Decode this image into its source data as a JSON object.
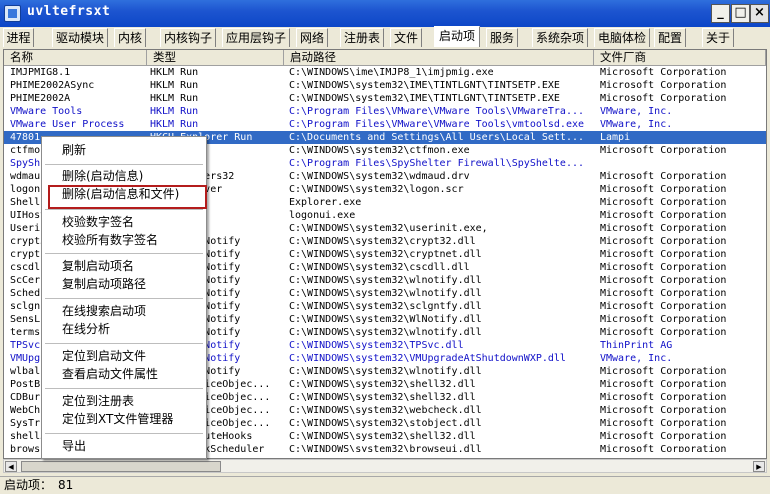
{
  "window": {
    "title": "uvltefrsxt",
    "controls": [
      "_",
      "□",
      "×"
    ]
  },
  "tabs": [
    "进程",
    "驱动模块",
    "内核",
    "内核钩子",
    "应用层钩子",
    "网络",
    "注册表",
    "文件",
    "启动项",
    "服务",
    "系统杂项",
    "电脑体检",
    "配置",
    "关于"
  ],
  "active_tab": "启动项",
  "columns": [
    "名称",
    "类型",
    "启动路径",
    "文件厂商"
  ],
  "rows": [
    {
      "name": "IMJPMIG8.1",
      "type": "HKLM Run",
      "path": "C:\\WINDOWS\\ime\\IMJP8_1\\imjpmig.exe",
      "vendor": "Microsoft Corporation",
      "style": "normal"
    },
    {
      "name": "PHIME2002ASync",
      "type": "HKLM Run",
      "path": "C:\\WINDOWS\\system32\\IME\\TINTLGNT\\TINTSETP.EXE",
      "vendor": "Microsoft Corporation",
      "style": "normal"
    },
    {
      "name": "PHIME2002A",
      "type": "HKLM Run",
      "path": "C:\\WINDOWS\\system32\\IME\\TINTLGNT\\TINTSETP.EXE",
      "vendor": "Microsoft Corporation",
      "style": "normal"
    },
    {
      "name": "VMware Tools",
      "type": "HKLM Run",
      "path": "C:\\Program Files\\VMware\\VMware Tools\\VMwareTra...",
      "vendor": "VMware, Inc.",
      "style": "blue"
    },
    {
      "name": "VMware User Process",
      "type": "HKLM Run",
      "path": "C:\\Program Files\\VMware\\VMware Tools\\vmtoolsd.exe",
      "vendor": "VMware, Inc.",
      "style": "blue"
    },
    {
      "name": "47801",
      "type": "HKCU Explorer Run",
      "path": "C:\\Documents and Settings\\All Users\\Local Sett...",
      "vendor": "Lampi",
      "style": "sel"
    },
    {
      "name": "ctfmon",
      "type": "HKCU Run",
      "path": "C:\\WINDOWS\\system32\\ctfmon.exe",
      "vendor": "Microsoft Corporation",
      "style": "normal"
    },
    {
      "name": "SpySh",
      "type": "HKLM Run",
      "path": "C:\\Program Files\\SpyShelter Firewall\\SpyShelte...",
      "vendor": "",
      "style": "blue"
    },
    {
      "name": "wdmau",
      "type": "HKLM Drivers32",
      "path": "C:\\WINDOWS\\system32\\wdmaud.drv",
      "vendor": "Microsoft Corporation",
      "style": "normal"
    },
    {
      "name": "logon.",
      "type": "Screen Saver",
      "path": "C:\\WINDOWS\\system32\\logon.scr",
      "vendor": "Microsoft Corporation",
      "style": "normal"
    },
    {
      "name": "Shell",
      "type": "Winlogon",
      "path": "Explorer.exe",
      "vendor": "Microsoft Corporation",
      "style": "normal"
    },
    {
      "name": "UIHost",
      "type": "Winlogon",
      "path": "logonui.exe",
      "vendor": "Microsoft Corporation",
      "style": "normal"
    },
    {
      "name": "Userin",
      "type": "Winlogon",
      "path": "C:\\WINDOWS\\system32\\userinit.exe,",
      "vendor": "Microsoft Corporation",
      "style": "normal"
    },
    {
      "name": "crypt3",
      "type": "Winlogon Notify",
      "path": "C:\\WINDOWS\\system32\\crypt32.dll",
      "vendor": "Microsoft Corporation",
      "style": "normal"
    },
    {
      "name": "crypt",
      "type": "Winlogon Notify",
      "path": "C:\\WINDOWS\\system32\\cryptnet.dll",
      "vendor": "Microsoft Corporation",
      "style": "normal"
    },
    {
      "name": "cscdl",
      "type": "Winlogon Notify",
      "path": "C:\\WINDOWS\\system32\\cscdll.dll",
      "vendor": "Microsoft Corporation",
      "style": "normal"
    },
    {
      "name": "ScCer",
      "type": "Winlogon Notify",
      "path": "C:\\WINDOWS\\system32\\wlnotify.dll",
      "vendor": "Microsoft Corporation",
      "style": "normal"
    },
    {
      "name": "Schedu",
      "type": "Winlogon Notify",
      "path": "C:\\WINDOWS\\system32\\wlnotify.dll",
      "vendor": "Microsoft Corporation",
      "style": "normal"
    },
    {
      "name": "sclgn",
      "type": "Winlogon Notify",
      "path": "C:\\WINDOWS\\system32\\sclgntfy.dll",
      "vendor": "Microsoft Corporation",
      "style": "normal"
    },
    {
      "name": "SensL",
      "type": "Winlogon Notify",
      "path": "C:\\WINDOWS\\system32\\WlNotify.dll",
      "vendor": "Microsoft Corporation",
      "style": "normal"
    },
    {
      "name": "termsr",
      "type": "Winlogon Notify",
      "path": "C:\\WINDOWS\\system32\\wlnotify.dll",
      "vendor": "Microsoft Corporation",
      "style": "normal"
    },
    {
      "name": "TPSvc",
      "type": "Winlogon Notify",
      "path": "C:\\WINDOWS\\system32\\TPSvc.dll",
      "vendor": "ThinPrint AG",
      "style": "blue"
    },
    {
      "name": "VMUpg",
      "type": "Winlogon Notify",
      "path": "C:\\WINDOWS\\system32\\VMUpgradeAtShutdownWXP.dll",
      "vendor": "VMware, Inc.",
      "style": "blue"
    },
    {
      "name": "wlbal",
      "type": "Winlogon Notify",
      "path": "C:\\WINDOWS\\system32\\wlnotify.dll",
      "vendor": "Microsoft Corporation",
      "style": "normal"
    },
    {
      "name": "PostB",
      "type": "ShellServiceObjec...",
      "path": "C:\\WINDOWS\\system32\\shell32.dll",
      "vendor": "Microsoft Corporation",
      "style": "normal"
    },
    {
      "name": "CDBur",
      "type": "ShellServiceObjec...",
      "path": "C:\\WINDOWS\\system32\\shell32.dll",
      "vendor": "Microsoft Corporation",
      "style": "normal"
    },
    {
      "name": "WebCh",
      "type": "ShellServiceObjec...",
      "path": "C:\\WINDOWS\\system32\\webcheck.dll",
      "vendor": "Microsoft Corporation",
      "style": "normal"
    },
    {
      "name": "SysTr",
      "type": "ShellServiceObjec...",
      "path": "C:\\WINDOWS\\system32\\stobject.dll",
      "vendor": "Microsoft Corporation",
      "style": "normal"
    },
    {
      "name": "shell3",
      "type": "ShellExecuteHooks",
      "path": "C:\\WINDOWS\\system32\\shell32.dll",
      "vendor": "Microsoft Corporation",
      "style": "normal"
    },
    {
      "name": "brows",
      "type": "SharedTaskScheduler",
      "path": "C:\\WINDOWS\\system32\\browseui.dll",
      "vendor": "Microsoft Corporation",
      "style": "normal"
    }
  ],
  "context_menu": {
    "items": [
      "刷新",
      "删除(启动信息)",
      "删除(启动信息和文件)",
      "校验数字签名",
      "校验所有数字签名",
      "复制启动项名",
      "复制启动项路径",
      "在线搜索启动项",
      "在线分析",
      "定位到启动文件",
      "查看启动文件属性",
      "定位到注册表",
      "定位到XT文件管理器",
      "导出"
    ],
    "highlighted": "删除(启动信息和文件)",
    "highlight_color": "#b41c1c"
  },
  "status": {
    "label": "启动项：",
    "count": "81"
  },
  "colors": {
    "title_bar": "#0c46c7",
    "selection": "#316ac5",
    "blue_text": "#1010c8",
    "face": "#ECE9D8"
  }
}
